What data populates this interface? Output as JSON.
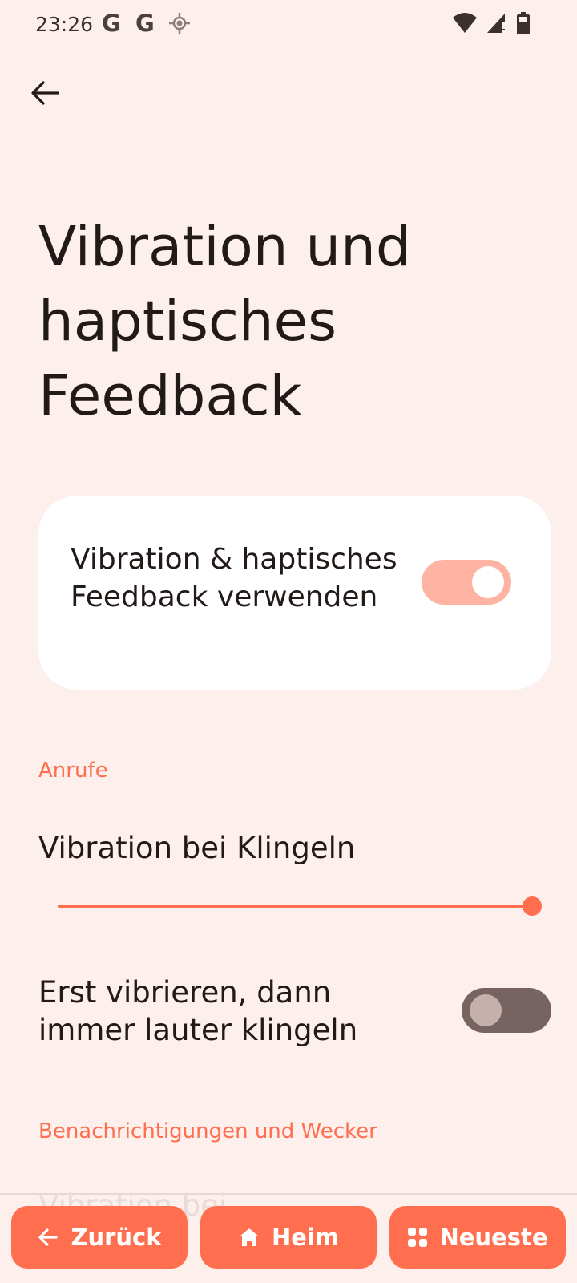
{
  "status_bar": {
    "time": "23:26",
    "left_icons": [
      "google-icon",
      "google-icon",
      "location-icon"
    ],
    "right_icons": [
      "wifi-icon",
      "cell-signal-icon",
      "battery-icon"
    ]
  },
  "header": {
    "back_icon": "arrow-left-icon",
    "title": "Vibration und haptisches Feedback"
  },
  "main_toggle": {
    "label": "Vibration & haptisches Feedback verwenden",
    "checked": true
  },
  "sections": {
    "calls": {
      "header": "Anrufe",
      "ring_vibration": {
        "label": "Vibration bei Klingeln",
        "level": 1.0
      },
      "vibrate_then_ring": {
        "label": "Erst vibrieren, dann immer lauter klingeln",
        "checked": false
      }
    },
    "notifications": {
      "header": "Benachrichtigungen und Wecker",
      "partial_item": "Vibration bei"
    }
  },
  "nav": {
    "back_label": "Zurück",
    "home_label": "Heim",
    "recents_label": "Neueste"
  },
  "colors": {
    "background": "#fcefec",
    "accent": "#ff6e4e",
    "switch_on_track": "#ffb3a2",
    "switch_off_track": "#776361"
  }
}
